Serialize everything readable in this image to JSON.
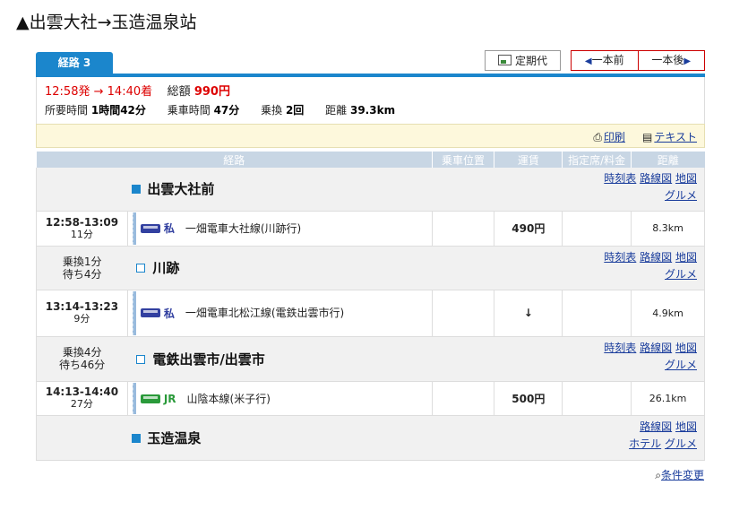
{
  "title": "▲出雲大社→玉造温泉站",
  "tab_label": "経路 3",
  "buttons": {
    "teiki": "定期代",
    "prev": "一本前",
    "next": "一本後"
  },
  "summary": {
    "dep": "12:58発",
    "arrow": "→",
    "arr": "14:40着",
    "total_label": "総額",
    "total_value": "990円",
    "duration_label": "所要時間",
    "duration_value": "1時間42分",
    "ride_label": "乗車時間",
    "ride_value": "47分",
    "transfer_label": "乗換",
    "transfer_value": "2回",
    "distance_label": "距離",
    "distance_value": "39.3km"
  },
  "links": {
    "print": "印刷",
    "text": "テキスト",
    "timetable": "時刻表",
    "routemap": "路線図",
    "map": "地図",
    "gourmet": "グルメ",
    "hotel": "ホテル",
    "conditions": "条件変更"
  },
  "columns": [
    "経路",
    "乗車位置",
    "運賃",
    "指定席/料金",
    "距離"
  ],
  "stations": [
    {
      "name": "出雲大社前"
    },
    {
      "name": "川跡",
      "transfer": "乗換1分",
      "wait": "待ち4分"
    },
    {
      "name": "電鉄出雲市/出雲市",
      "transfer": "乗換4分",
      "wait": "待ち46分"
    },
    {
      "name": "玉造温泉"
    }
  ],
  "segments": [
    {
      "time": "12:58-13:09",
      "dur": "11分",
      "op": "私",
      "line": "一畑電車大社線(川跡行)",
      "fare": "490円",
      "dist": "8.3km"
    },
    {
      "time": "13:14-13:23",
      "dur": "9分",
      "op": "私",
      "line": "一畑電車北松江線(電鉄出雲市行)",
      "fare": "↓",
      "dist": "4.9km"
    },
    {
      "time": "14:13-14:40",
      "dur": "27分",
      "op": "JR",
      "line": "山陰本線(米子行)",
      "fare": "500円",
      "dist": "26.1km"
    }
  ]
}
